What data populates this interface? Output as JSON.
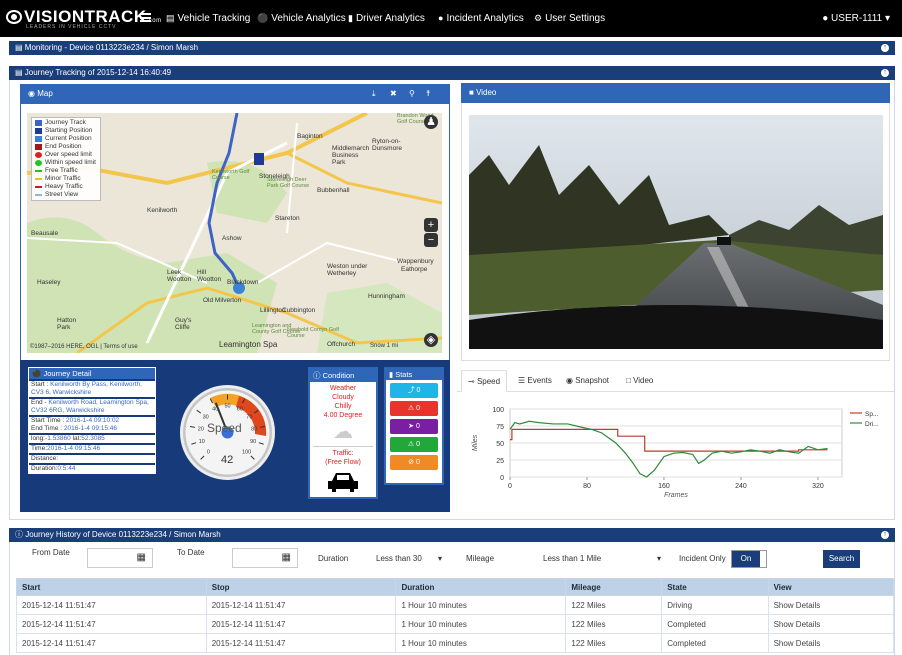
{
  "topnav": {
    "brand": "VISIONTRACK",
    "brand_suffix": ".com",
    "tagline": "LEADERS IN VEHICLE CCTV",
    "items": [
      {
        "label": "Vehicle Tracking",
        "icon": "laptop-icon"
      },
      {
        "label": "Vehicle Analytics",
        "icon": "car-icon"
      },
      {
        "label": "Driver Analytics",
        "icon": "bar-chart-icon"
      },
      {
        "label": "Incident Analytics",
        "icon": "incident-icon"
      },
      {
        "label": "User Settings",
        "icon": "gears-icon"
      }
    ],
    "user": "USER-1111"
  },
  "monitoring_bar": {
    "title": "Monitoring - Device 0113223e234 / Simon Marsh"
  },
  "journey_bar": {
    "title": "Journey Tracking of 2015-12-14 16:40:49"
  },
  "map_panel": {
    "title": "Map",
    "legend": [
      {
        "label": "Journey Track",
        "color": "#3e62c7"
      },
      {
        "label": "Starting Position",
        "color": "#1f3a93"
      },
      {
        "label": "Current Position",
        "color": "#3b82d6"
      },
      {
        "label": "End Position",
        "color": "#9b1b1b"
      },
      {
        "label": "Over speed limit",
        "color": "#e02020"
      },
      {
        "label": "Within speed limit",
        "color": "#22c322"
      },
      {
        "label": "Free Traffic",
        "color": "#22c322"
      },
      {
        "label": "Minor Traffic",
        "color": "#e6c229"
      },
      {
        "label": "Heavy Traffic",
        "color": "#c21f1f"
      },
      {
        "label": "Street View",
        "color": "#8fb5d8"
      }
    ],
    "places": [
      "Baginton",
      "Middlemarch Business Park",
      "Ryton-on-Dunsmore",
      "Stoneleigh",
      "Kenilworth",
      "Bubbenhall",
      "Stareton",
      "Ashow",
      "Beausale",
      "Leek Wootton",
      "Hill Wootton",
      "Weston under Wetherley",
      "Wappenbury",
      "Eathorpe",
      "Haseley",
      "Blackdown",
      "Cubbington",
      "Hunningham",
      "Old Milverton",
      "Lillington",
      "Guy's Cliffe",
      "Leamington Spa",
      "Offchurch",
      "Hatton Park",
      "Kenilworth Golf Course",
      "Stoneleigh Deer Park Golf Course",
      "Leamington and County Golf Course",
      "Newbold Comyn Golf Course",
      "Brandon Wood Golf Course"
    ],
    "copyright": "©1987–2016 HERE, OGL | Terms of use",
    "scale_label": "Snow 1 mi",
    "zoom_in": "+",
    "zoom_out": "−"
  },
  "journey_detail": {
    "title": "Journey Detail",
    "start_label": "Start :",
    "start_value": "Kenilworth By Pass, Kenilworth, CV3 6, Warwickshire",
    "end_label": "End -",
    "end_value": "Kenilworth Road, Leamington Spa, CV32 6RG, Warwickshire",
    "start_time_label": "Start Time :",
    "start_time_value": "2016-1-4 09:10:02",
    "end_time_label": "End Time :",
    "end_time_value": "2016-1-4 09:15:46",
    "long_label": "long:",
    "long_value": "-1.53860",
    "lat_label": "lat:",
    "lat_value": "52.3085",
    "time_label": "Time:",
    "time_value": "2016-1-4 09:15:46",
    "distance_label": "Distance:",
    "distance_value": "",
    "duration_label": "Duration:",
    "duration_value": "0:5:44"
  },
  "speedometer": {
    "label": "Speed",
    "value": "42",
    "reading": 42,
    "ticks": [
      "0",
      "10",
      "20",
      "30",
      "40",
      "50",
      "60",
      "70",
      "80",
      "90",
      "100"
    ]
  },
  "condition": {
    "title": "Condition",
    "weather": [
      "Weather",
      "Cloudy",
      "Chilly",
      "4.00 Degree"
    ],
    "traffic": [
      "Traffic:",
      "(Free Flow)"
    ]
  },
  "stats": {
    "title": "Stats",
    "buttons": [
      {
        "label": "0",
        "color": "#1fb5e6",
        "icon": "bolt-icon"
      },
      {
        "label": "0",
        "color": "#e8342c",
        "icon": "warning-icon"
      },
      {
        "label": "0",
        "color": "#7a1fa2",
        "icon": "plane-icon"
      },
      {
        "label": "0",
        "color": "#22a83a",
        "icon": "warning-icon"
      },
      {
        "label": "0",
        "color": "#f08a24",
        "icon": "ban-icon"
      }
    ]
  },
  "video_panel": {
    "title": "Video"
  },
  "tabs": [
    {
      "label": "Speed",
      "icon": "speed-icon",
      "active": true
    },
    {
      "label": "Events",
      "icon": "list-icon",
      "active": false
    },
    {
      "label": "Snapshot",
      "icon": "camera-icon",
      "active": false
    },
    {
      "label": "Video",
      "icon": "file-icon",
      "active": false
    }
  ],
  "chart_data": {
    "type": "line",
    "title": "",
    "xlabel": "Frames",
    "ylabel": "Miles",
    "xlim": [
      0,
      345
    ],
    "ylim": [
      0,
      100
    ],
    "xticks": [
      "0",
      "80",
      "160",
      "240",
      "320"
    ],
    "yticks": [
      "0",
      "25",
      "50",
      "75",
      "100"
    ],
    "legend_position": "right",
    "series": [
      {
        "name": "Sp...",
        "color": "#c0392b",
        "x": [
          0,
          2,
          2,
          112,
          112,
          140,
          140,
          300,
          300,
          330
        ],
        "values": [
          55,
          55,
          70,
          70,
          60,
          60,
          38,
          38,
          40,
          40
        ]
      },
      {
        "name": "Dri...",
        "color": "#2e8b3a",
        "x": [
          0,
          5,
          10,
          20,
          30,
          45,
          60,
          75,
          85,
          95,
          110,
          120,
          128,
          135,
          142,
          150,
          160,
          170,
          180,
          190,
          196,
          202,
          210,
          220,
          230,
          240,
          250,
          260,
          270,
          280,
          290,
          300,
          310,
          320,
          330
        ],
        "values": [
          70,
          80,
          78,
          82,
          80,
          78,
          78,
          73,
          70,
          65,
          50,
          35,
          20,
          5,
          0,
          10,
          30,
          35,
          36,
          33,
          20,
          25,
          35,
          38,
          35,
          37,
          40,
          38,
          35,
          40,
          37,
          35,
          45,
          40,
          42
        ]
      }
    ]
  },
  "history_bar": {
    "title": "Journey History of Device 0113223e234 / Simon Marsh"
  },
  "filters": {
    "from_label": "From Date",
    "to_label": "To Date",
    "duration_label": "Duration",
    "duration_value": "Less than 30",
    "mileage_label": "Mileage",
    "mileage_value": "Less than 1 Mile",
    "incident_label": "Incident Only",
    "toggle_label": "On",
    "search_label": "Search"
  },
  "table": {
    "columns": [
      "Start",
      "Stop",
      "Duration",
      "Mileage",
      "State",
      "View"
    ],
    "rows": [
      [
        "2015-12-14 11:51:47",
        "2015-12-14 11:51:47",
        "1 Hour 10 minutes",
        "122 Miles",
        "Driving",
        "Show Details"
      ],
      [
        "2015-12-14 11:51:47",
        "2015-12-14 11:51:47",
        "1 Hour 10 minutes",
        "122 Miles",
        "Completed",
        "Show Details"
      ],
      [
        "2015-12-14 11:51:47",
        "2015-12-14 11:51:47",
        "1 Hour 10 minutes",
        "122 Miles",
        "Completed",
        "Show Details"
      ]
    ]
  }
}
